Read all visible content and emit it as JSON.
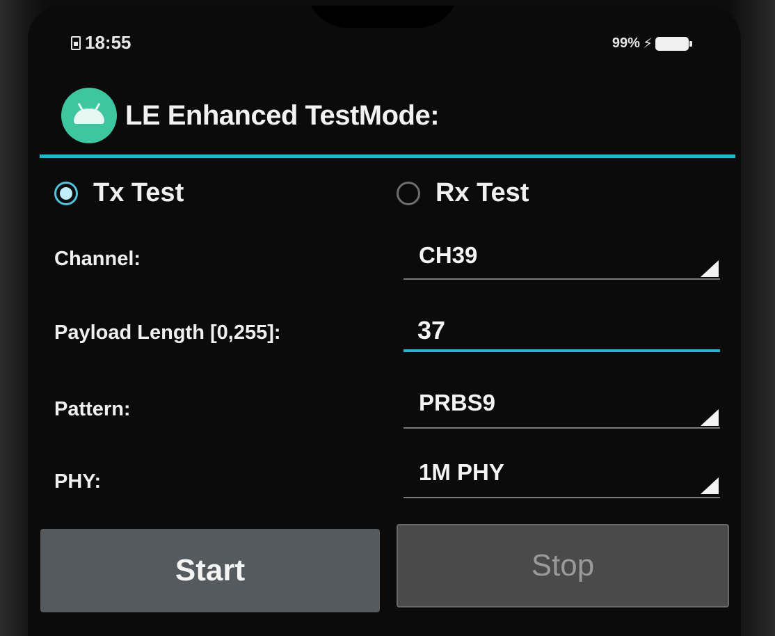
{
  "status_bar": {
    "time": "18:55",
    "battery_percent": "99%",
    "icons": [
      "sim-icon",
      "charging-bolt-icon",
      "battery-icon"
    ]
  },
  "app": {
    "title": "LE Enhanced TestMode:",
    "icon": "android-app-icon",
    "accent_color": "#29b3cf"
  },
  "mode": {
    "tx_label": "Tx Test",
    "rx_label": "Rx Test",
    "selected": "tx"
  },
  "form": {
    "channel": {
      "label": "Channel:",
      "value": "CH39"
    },
    "payload_length": {
      "label": "Payload Length [0,255]:",
      "value": "37"
    },
    "pattern": {
      "label": "Pattern:",
      "value": "PRBS9"
    },
    "phy": {
      "label": "PHY:",
      "value": "1M PHY"
    }
  },
  "actions": {
    "start_label": "Start",
    "stop_label": "Stop"
  }
}
